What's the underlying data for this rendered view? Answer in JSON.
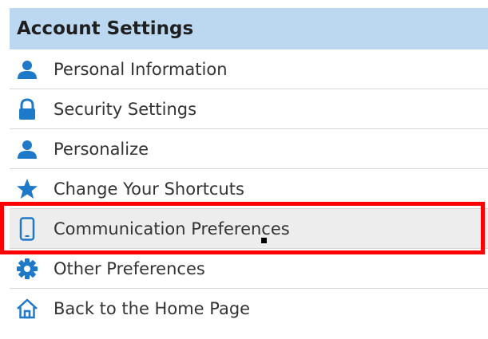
{
  "panel": {
    "title": "Account Settings"
  },
  "menu": {
    "items": [
      {
        "label": "Personal Information",
        "icon": "user-icon"
      },
      {
        "label": "Security Settings",
        "icon": "lock-icon"
      },
      {
        "label": "Personalize",
        "icon": "user-icon"
      },
      {
        "label": "Change Your Shortcuts",
        "icon": "star-icon"
      },
      {
        "label": "Communication Preferences",
        "icon": "mobile-phone-icon"
      },
      {
        "label": "Other Preferences",
        "icon": "gear-icon"
      },
      {
        "label": "Back to the Home Page",
        "icon": "home-icon"
      }
    ],
    "active_item": "Communication Preferences"
  },
  "colors": {
    "accent": "#1e79c8",
    "header_background": "#bcd8f1",
    "highlight_border": "#ff0000",
    "active_background": "#ededed"
  }
}
